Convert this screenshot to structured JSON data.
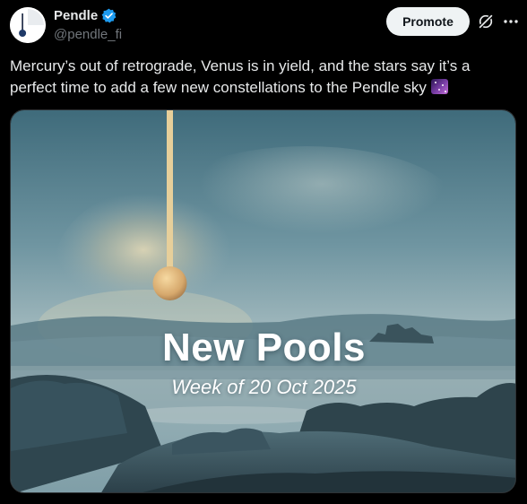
{
  "account": {
    "display_name": "Pendle",
    "handle": "@pendle_fi",
    "verified": true
  },
  "actions": {
    "promote_label": "Promote",
    "grok_icon": "grok-icon",
    "more_icon": "more-icon"
  },
  "tweet": {
    "text": "Mercury’s out of retrograde, Venus is in yield, and the stars say it’s a perfect time to add a few new constellations to the Pendle sky",
    "emoji": "milky-way-emoji"
  },
  "media": {
    "headline": "New Pools",
    "subheadline": "Week of 20 Oct 2025"
  },
  "colors": {
    "background": "#000000",
    "text": "#e7e9ea",
    "secondary_text": "#71767b",
    "verified_badge": "#1d9bf0",
    "button_bg": "#eff3f4",
    "pendulum": "#e7cf9a"
  }
}
